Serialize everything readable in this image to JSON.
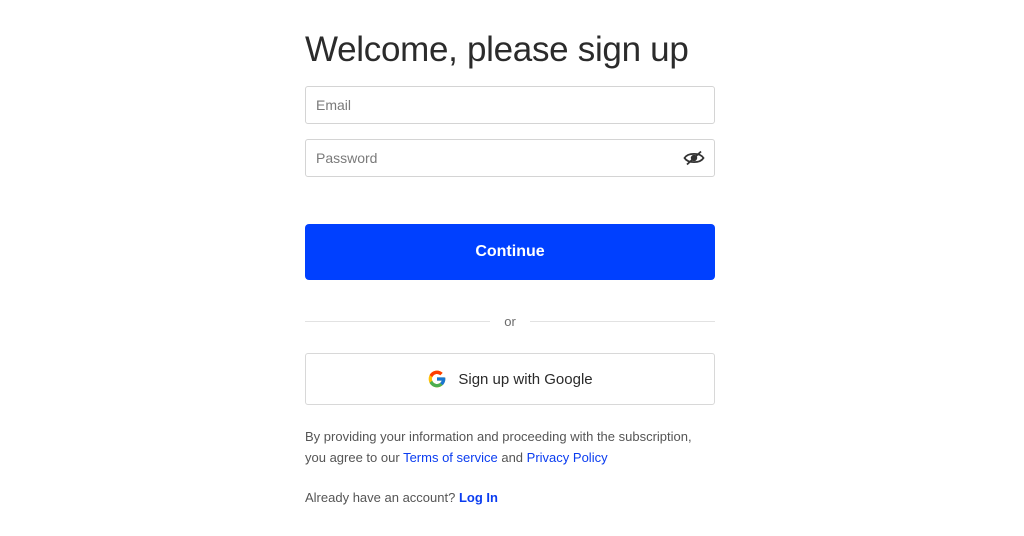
{
  "form": {
    "title": "Welcome, please sign up",
    "email": {
      "placeholder": "Email",
      "value": ""
    },
    "password": {
      "placeholder": "Password",
      "value": "",
      "toggle_icon": "eye-slash-icon"
    },
    "continue_label": "Continue",
    "divider_label": "or",
    "google": {
      "label": "Sign up with Google",
      "icon": "google-logo-icon"
    },
    "terms": {
      "line1": "By providing your information and proceeding with the subscription,",
      "line2_prefix": "you agree to our",
      "terms_link": "Terms of service",
      "and": "and",
      "privacy_link": "Privacy Policy"
    },
    "login": {
      "prompt": "Already have an account?",
      "link": "Log In"
    }
  },
  "colors": {
    "primary": "#0040ff",
    "link": "#0a3cf0",
    "border": "#d4d4d4",
    "text": "#2b2b2b"
  }
}
